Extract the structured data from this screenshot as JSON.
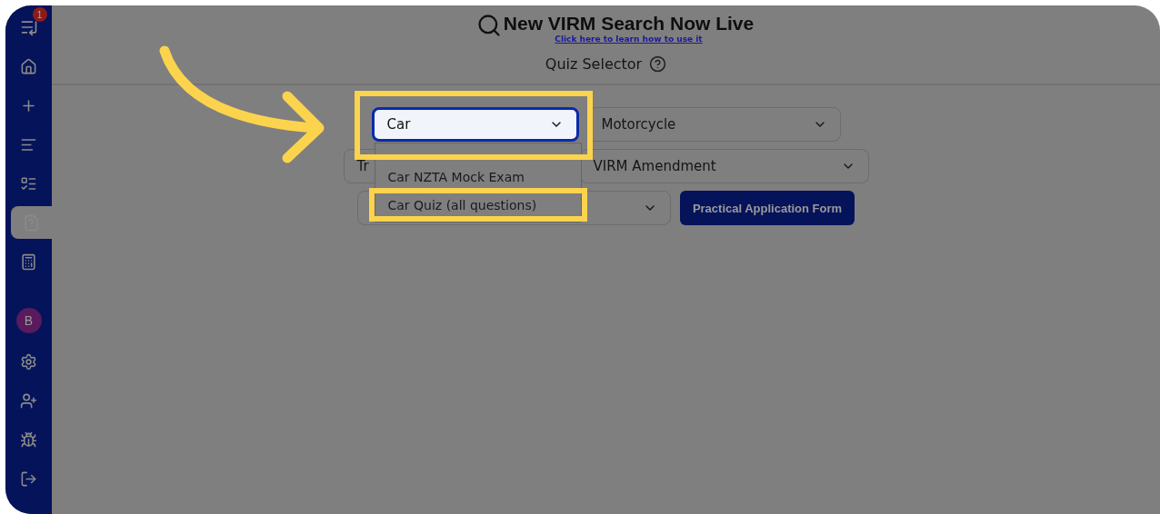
{
  "sidebar": {
    "badge": "1",
    "items": [
      {
        "kind": "home",
        "selected": false
      },
      {
        "kind": "add",
        "selected": false
      },
      {
        "kind": "list",
        "selected": false
      },
      {
        "kind": "edit",
        "selected": false
      },
      {
        "kind": "quiz",
        "selected": true
      },
      {
        "kind": "calculator",
        "selected": false
      }
    ],
    "avatar": "B",
    "bottom_items": [
      {
        "kind": "settings"
      },
      {
        "kind": "add-user"
      },
      {
        "kind": "bug"
      },
      {
        "kind": "logout"
      }
    ]
  },
  "banner": {
    "title": "New VIRM Search Now Live",
    "link": "Click here to learn how to use it"
  },
  "heading": "Quiz Selector",
  "rows": [
    [
      {
        "kind": "select",
        "value": "Car",
        "focused": true
      },
      {
        "kind": "select",
        "value": "Motorcycle",
        "focused": false
      }
    ],
    [
      {
        "kind": "select",
        "value": "Tr",
        "focused": false
      },
      {
        "kind": "select",
        "value": "VIRM Amendment",
        "focused": false
      }
    ],
    [
      {
        "kind": "select",
        "focused": false
      },
      {
        "kind": "button",
        "value": "Practical Application Form"
      }
    ]
  ],
  "dropdown": {
    "options": [
      {
        "label": "Car NZTA Mock Exam",
        "highlighted": false
      },
      {
        "label": "Car Quiz (all questions)",
        "highlighted": true
      }
    ]
  }
}
